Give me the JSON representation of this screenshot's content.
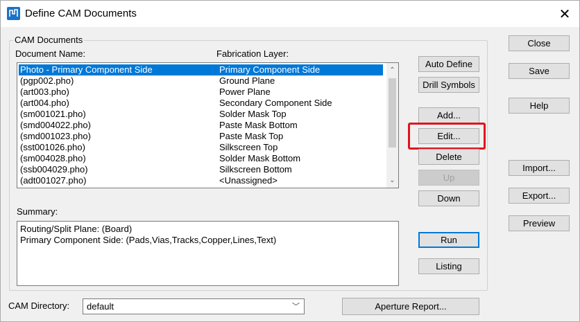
{
  "window": {
    "title": "Define CAM Documents",
    "close_glyph": "✕"
  },
  "cam_documents": {
    "group_label": "CAM Documents",
    "col_document": "Document Name:",
    "col_layer": "Fabrication Layer:",
    "rows": [
      {
        "name": "Photo - Primary Component Side",
        "layer": "Primary Component Side",
        "selected": true
      },
      {
        "name": "(pgp002.pho)",
        "layer": "Ground Plane"
      },
      {
        "name": "(art003.pho)",
        "layer": "Power Plane"
      },
      {
        "name": "(art004.pho)",
        "layer": "Secondary Component Side"
      },
      {
        "name": "(sm001021.pho)",
        "layer": "Solder Mask Top"
      },
      {
        "name": "(smd004022.pho)",
        "layer": "Paste Mask Bottom"
      },
      {
        "name": "(smd001023.pho)",
        "layer": "Paste Mask Top"
      },
      {
        "name": "(sst001026.pho)",
        "layer": "Silkscreen Top"
      },
      {
        "name": "(sm004028.pho)",
        "layer": "Solder Mask Bottom"
      },
      {
        "name": "(ssb004029.pho)",
        "layer": "Silkscreen Bottom"
      },
      {
        "name": "(adt001027.pho)",
        "layer": "<Unassigned>"
      }
    ],
    "summary_label": "Summary:",
    "summary_lines": [
      "Routing/Split Plane: (Board)",
      "Primary Component Side: (Pads,Vias,Tracks,Copper,Lines,Text)"
    ]
  },
  "buttons": {
    "auto_define": "Auto Define",
    "drill_symbols": "Drill Symbols",
    "add": "Add...",
    "edit": "Edit...",
    "delete": "Delete",
    "up": "Up",
    "down": "Down",
    "run": "Run",
    "listing": "Listing",
    "close": "Close",
    "save": "Save",
    "help": "Help",
    "import": "Import...",
    "export": "Export...",
    "preview": "Preview",
    "aperture_report": "Aperture Report..."
  },
  "cam_directory": {
    "label": "CAM Directory:",
    "value": "default"
  },
  "colors": {
    "selection": "#0078d7",
    "highlight_box": "#e0131f"
  }
}
